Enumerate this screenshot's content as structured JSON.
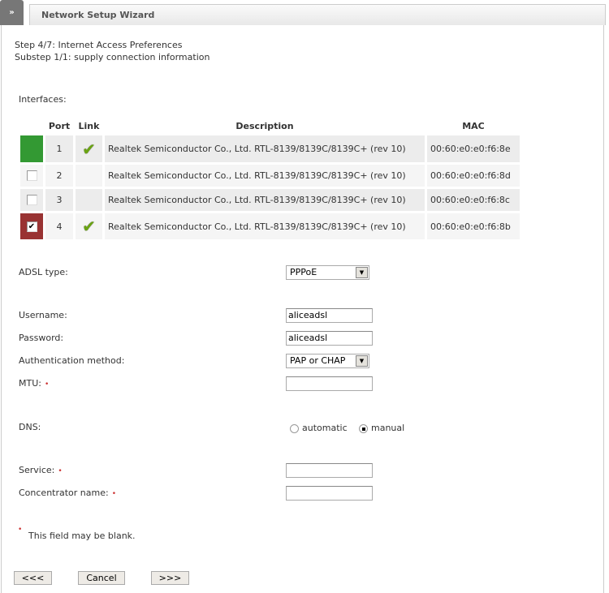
{
  "header": {
    "toggle_icon": "»",
    "title": "Network Setup Wizard"
  },
  "step": "Step 4/7: Internet Access Preferences",
  "substep": "Substep 1/1: supply connection information",
  "interfaces": {
    "label": "Interfaces:",
    "columns": [
      "Port",
      "Link",
      "Description",
      "MAC"
    ],
    "rows": [
      {
        "port": "1",
        "link": true,
        "state": "active-green",
        "description": "Realtek Semiconductor Co., Ltd. RTL-8139/8139C/8139C+ (rev 10)",
        "mac": "00:60:e0:e0:f6:8e"
      },
      {
        "port": "2",
        "link": false,
        "state": "unchecked",
        "description": "Realtek Semiconductor Co., Ltd. RTL-8139/8139C/8139C+ (rev 10)",
        "mac": "00:60:e0:e0:f6:8d"
      },
      {
        "port": "3",
        "link": false,
        "state": "unchecked",
        "description": "Realtek Semiconductor Co., Ltd. RTL-8139/8139C/8139C+ (rev 10)",
        "mac": "00:60:e0:e0:f6:8c"
      },
      {
        "port": "4",
        "link": true,
        "state": "checked",
        "description": "Realtek Semiconductor Co., Ltd. RTL-8139/8139C/8139C+ (rev 10)",
        "mac": "00:60:e0:e0:f6:8b"
      }
    ]
  },
  "form": {
    "adsl_type_label": "ADSL type:",
    "adsl_type_value": "PPPoE",
    "username_label": "Username:",
    "username_value": "aliceadsl",
    "password_label": "Password:",
    "password_value": "aliceadsl",
    "auth_label": "Authentication method:",
    "auth_value": "PAP or CHAP",
    "mtu_label": "MTU:",
    "mtu_value": "",
    "dns_label": "DNS:",
    "dns_automatic": "automatic",
    "dns_manual": "manual",
    "dns_selected": "manual",
    "service_label": "Service:",
    "service_value": "",
    "concentrator_label": "Concentrator name:",
    "concentrator_value": ""
  },
  "note": "This field may be blank.",
  "buttons": {
    "back": "<<<",
    "cancel": "Cancel",
    "next": ">>>"
  },
  "colors": {
    "green": "#339933",
    "red": "#993333"
  }
}
